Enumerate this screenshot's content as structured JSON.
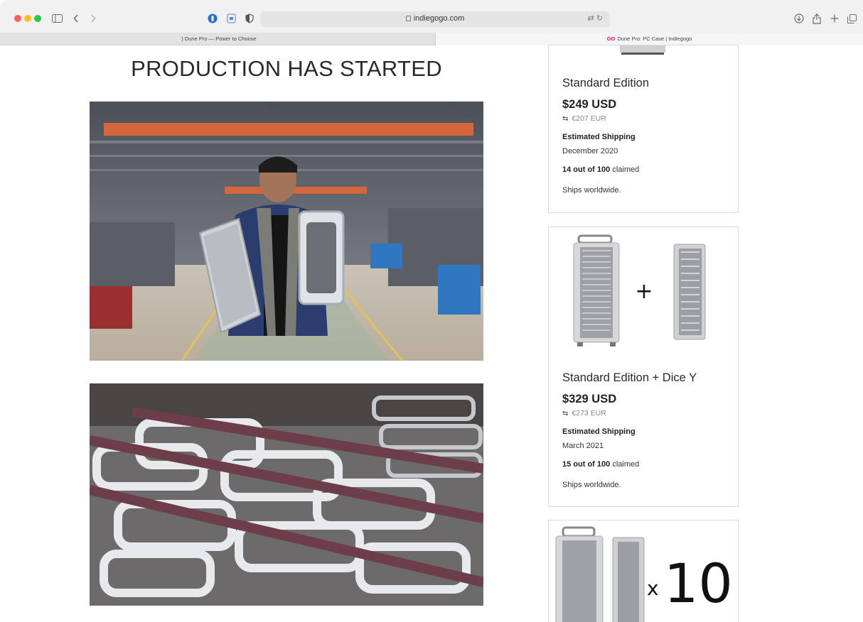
{
  "browser": {
    "url": "indiegogo.com",
    "tabs": [
      {
        "label": "Dune Pro — Power to Choose",
        "active": false
      },
      {
        "label": "Dune Pro: PC Case | Indiegogo",
        "badge": "GO",
        "active": true
      }
    ]
  },
  "campaign": {
    "heading": "PRODUCTION HAS STARTED"
  },
  "rewards": [
    {
      "title": "Standard Edition",
      "price": "$249 USD",
      "price_eur": "€207 EUR",
      "shipping_label": "Estimated Shipping",
      "shipping_date": "December 2020",
      "claimed_count": "14 out of 100",
      "claimed_suffix": "claimed",
      "ships": "Ships worldwide."
    },
    {
      "title": "Standard Edition + Dice Y",
      "price": "$329 USD",
      "price_eur": "€273 EUR",
      "shipping_label": "Estimated Shipping",
      "shipping_date": "March 2021",
      "claimed_count": "15 out of 100",
      "claimed_suffix": "claimed",
      "ships": "Ships worldwide.",
      "image_text": "+"
    },
    {
      "image_text": "x10"
    }
  ],
  "colors": {
    "brand_go": "#e51075"
  }
}
